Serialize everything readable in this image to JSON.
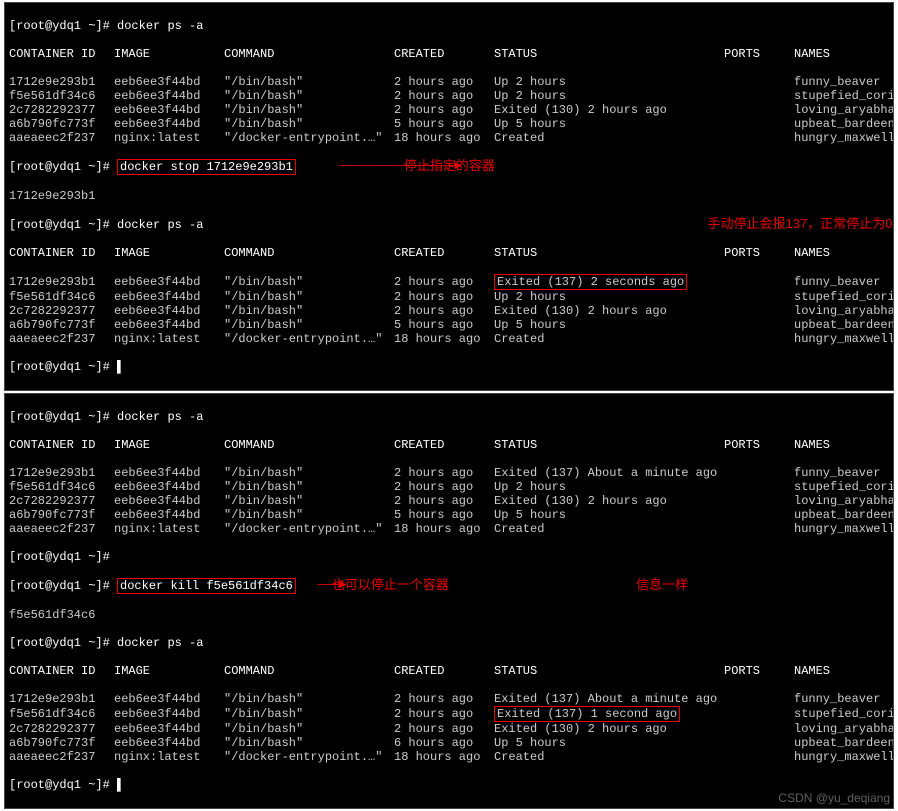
{
  "prompt": "[root@ydq1 ~]#",
  "cmd_ps": "docker ps -a",
  "cmd_stop": "docker stop 1712e9e293b1",
  "stop_echo": "1712e9e293b1",
  "cmd_kill": "docker kill f5e561df34c6",
  "kill_echo": "f5e561df34c6",
  "header": {
    "id": "CONTAINER ID",
    "image": "IMAGE",
    "command": "COMMAND",
    "created": "CREATED",
    "status": "STATUS",
    "ports": "PORTS",
    "names": "NAMES"
  },
  "t1_rows": [
    {
      "id": "1712e9e293b1",
      "image": "eeb6ee3f44bd",
      "command": "\"/bin/bash\"",
      "created": "2 hours ago",
      "status": "Up 2 hours",
      "names": "funny_beaver"
    },
    {
      "id": "f5e561df34c6",
      "image": "eeb6ee3f44bd",
      "command": "\"/bin/bash\"",
      "created": "2 hours ago",
      "status": "Up 2 hours",
      "names": "stupefied_cori"
    },
    {
      "id": "2c7282292377",
      "image": "eeb6ee3f44bd",
      "command": "\"/bin/bash\"",
      "created": "2 hours ago",
      "status": "Exited (130) 2 hours ago",
      "names": "loving_aryabhata"
    },
    {
      "id": "a6b790fc773f",
      "image": "eeb6ee3f44bd",
      "command": "\"/bin/bash\"",
      "created": "5 hours ago",
      "status": "Up 5 hours",
      "names": "upbeat_bardeen"
    },
    {
      "id": "aaeaeec2f237",
      "image": "nginx:latest",
      "command": "\"/docker-entrypoint.…\"",
      "created": "18 hours ago",
      "status": "Created",
      "names": "hungry_maxwell"
    }
  ],
  "t2_rows": [
    {
      "id": "1712e9e293b1",
      "image": "eeb6ee3f44bd",
      "command": "\"/bin/bash\"",
      "created": "2 hours ago",
      "status": "Exited (137) 2 seconds ago",
      "names": "funny_beaver"
    },
    {
      "id": "f5e561df34c6",
      "image": "eeb6ee3f44bd",
      "command": "\"/bin/bash\"",
      "created": "2 hours ago",
      "status": "Up 2 hours",
      "names": "stupefied_cori"
    },
    {
      "id": "2c7282292377",
      "image": "eeb6ee3f44bd",
      "command": "\"/bin/bash\"",
      "created": "2 hours ago",
      "status": "Exited (130) 2 hours ago",
      "names": "loving_aryabhata"
    },
    {
      "id": "a6b790fc773f",
      "image": "eeb6ee3f44bd",
      "command": "\"/bin/bash\"",
      "created": "5 hours ago",
      "status": "Up 5 hours",
      "names": "upbeat_bardeen"
    },
    {
      "id": "aaeaeec2f237",
      "image": "nginx:latest",
      "command": "\"/docker-entrypoint.…\"",
      "created": "18 hours ago",
      "status": "Created",
      "names": "hungry_maxwell"
    }
  ],
  "t3_rows": [
    {
      "id": "1712e9e293b1",
      "image": "eeb6ee3f44bd",
      "command": "\"/bin/bash\"",
      "created": "2 hours ago",
      "status": "Exited (137) About a minute ago",
      "names": "funny_beaver"
    },
    {
      "id": "f5e561df34c6",
      "image": "eeb6ee3f44bd",
      "command": "\"/bin/bash\"",
      "created": "2 hours ago",
      "status": "Up 2 hours",
      "names": "stupefied_cori"
    },
    {
      "id": "2c7282292377",
      "image": "eeb6ee3f44bd",
      "command": "\"/bin/bash\"",
      "created": "2 hours ago",
      "status": "Exited (130) 2 hours ago",
      "names": "loving_aryabhata"
    },
    {
      "id": "a6b790fc773f",
      "image": "eeb6ee3f44bd",
      "command": "\"/bin/bash\"",
      "created": "5 hours ago",
      "status": "Up 5 hours",
      "names": "upbeat_bardeen"
    },
    {
      "id": "aaeaeec2f237",
      "image": "nginx:latest",
      "command": "\"/docker-entrypoint.…\"",
      "created": "18 hours ago",
      "status": "Created",
      "names": "hungry_maxwell"
    }
  ],
  "t4_rows": [
    {
      "id": "1712e9e293b1",
      "image": "eeb6ee3f44bd",
      "command": "\"/bin/bash\"",
      "created": "2 hours ago",
      "status": "Exited (137) About a minute ago",
      "names": "funny_beaver"
    },
    {
      "id": "f5e561df34c6",
      "image": "eeb6ee3f44bd",
      "command": "\"/bin/bash\"",
      "created": "2 hours ago",
      "status": "Exited (137) 1 second ago",
      "names": "stupefied_cori"
    },
    {
      "id": "2c7282292377",
      "image": "eeb6ee3f44bd",
      "command": "\"/bin/bash\"",
      "created": "2 hours ago",
      "status": "Exited (130) 2 hours ago",
      "names": "loving_aryabhata"
    },
    {
      "id": "a6b790fc773f",
      "image": "eeb6ee3f44bd",
      "command": "\"/bin/bash\"",
      "created": "6 hours ago",
      "status": "Up 5 hours",
      "names": "upbeat_bardeen"
    },
    {
      "id": "aaeaeec2f237",
      "image": "nginx:latest",
      "command": "\"/docker-entrypoint.…\"",
      "created": "18 hours ago",
      "status": "Created",
      "names": "hungry_maxwell"
    }
  ],
  "annot": {
    "stop_label": "停止指定的容器",
    "exit137_label": "手动停止会报137，正常停止为0",
    "kill_label": "也可以停止一个容器",
    "same_label": "信息一样"
  },
  "watermark": "CSDN @yu_deqiang"
}
